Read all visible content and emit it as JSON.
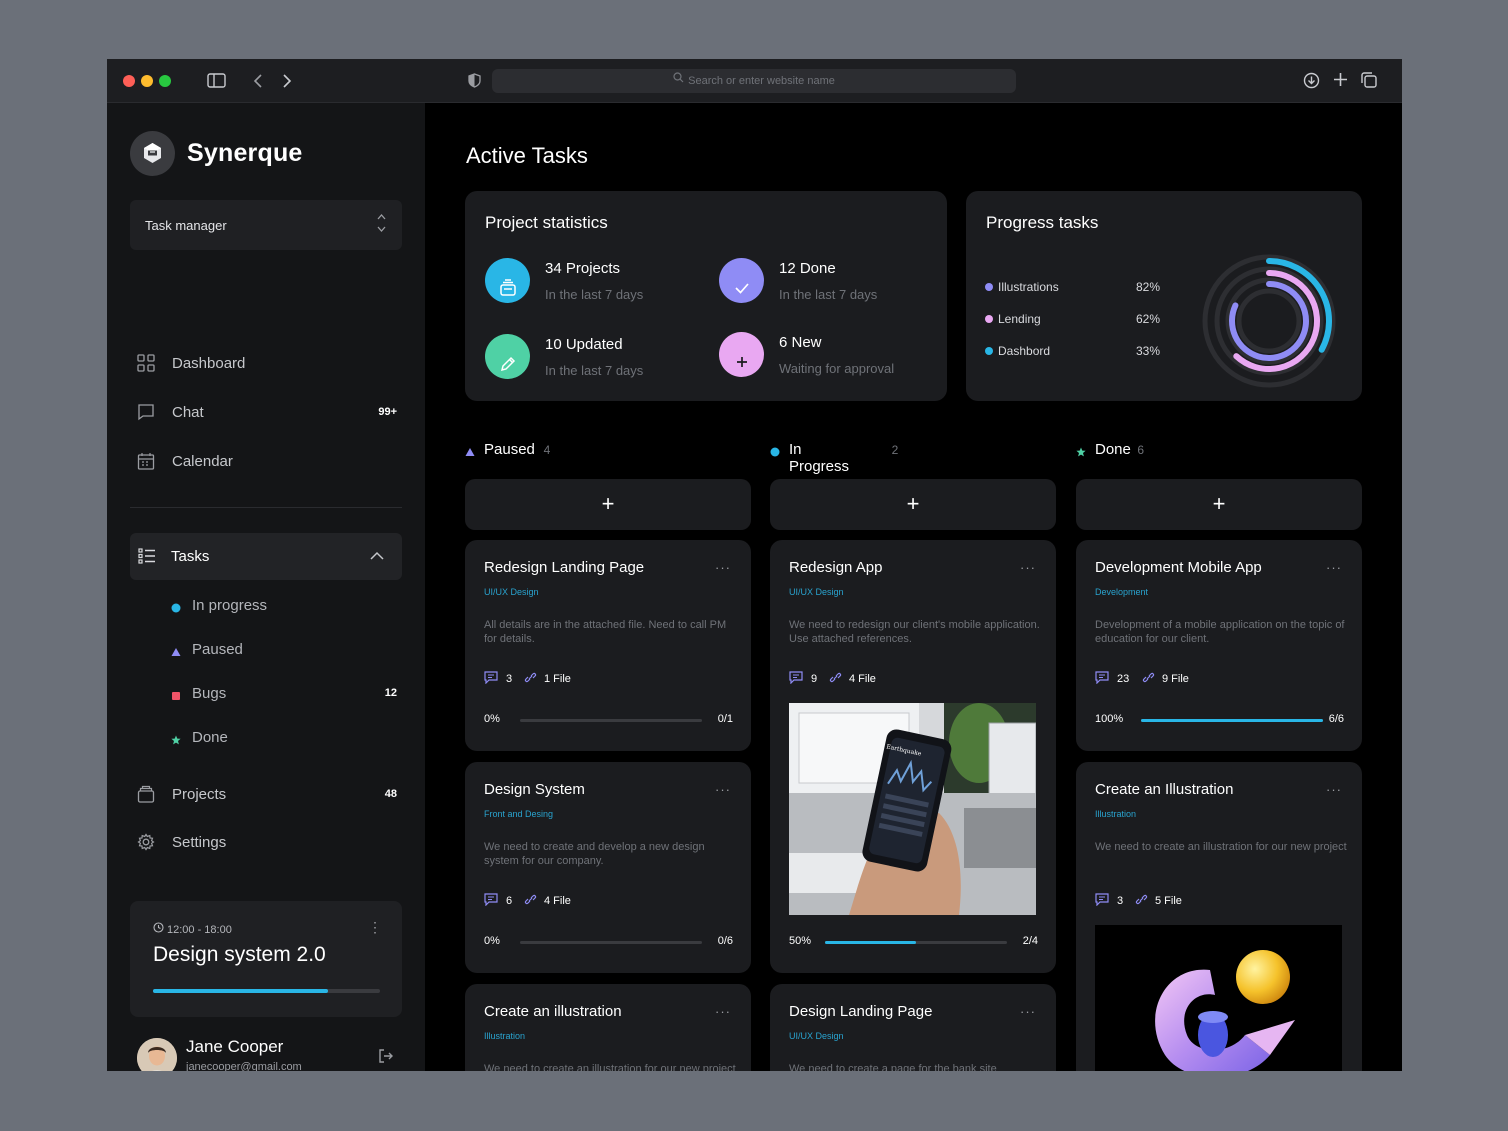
{
  "browser": {
    "url_placeholder": "Search or enter website name"
  },
  "brand": {
    "name": "Synerque"
  },
  "workspace_selector": {
    "value": "Task manager"
  },
  "nav": [
    {
      "label": "Dashboard",
      "icon": "grid-icon",
      "badge": ""
    },
    {
      "label": "Chat",
      "icon": "chat-icon",
      "badge": "99+"
    },
    {
      "label": "Calendar",
      "icon": "calendar-icon",
      "badge": ""
    }
  ],
  "tasks_menu": {
    "label": "Tasks",
    "items": [
      {
        "label": "In progress",
        "marker": "circle",
        "color": "#29b6e6",
        "badge": ""
      },
      {
        "label": "Paused",
        "marker": "triangle",
        "color": "#8f8cf5",
        "badge": ""
      },
      {
        "label": "Bugs",
        "marker": "square",
        "color": "#f05468",
        "badge": "12"
      },
      {
        "label": "Done",
        "marker": "star",
        "color": "#4fd1a5",
        "badge": ""
      }
    ]
  },
  "nav2": [
    {
      "label": "Projects",
      "icon": "folder-icon",
      "badge": "48"
    },
    {
      "label": "Settings",
      "icon": "gear-icon",
      "badge": ""
    }
  ],
  "event": {
    "time": "12:00 - 18:00",
    "title": "Design system 2.0",
    "progress": 0.77
  },
  "user": {
    "name": "Jane Cooper",
    "email": "janecooper@gmail.com"
  },
  "page_title": "Active Tasks",
  "stats": {
    "title": "Project statistics",
    "items": [
      {
        "value": "34 Projects",
        "sub": "In the last 7 days",
        "color": "#29b6e6",
        "icon": "stack-icon"
      },
      {
        "value": "12 Done",
        "sub": "In the last 7 days",
        "color": "#8f8cf5",
        "icon": "check-icon"
      },
      {
        "value": "10 Updated",
        "sub": "In the last 7 days",
        "color": "#4fd1a5",
        "icon": "pencil-icon"
      },
      {
        "value": "6 New",
        "sub": "Waiting for approval",
        "color": "#e9a8f2",
        "icon": "plus-icon"
      }
    ]
  },
  "progress": {
    "title": "Progress tasks",
    "items": [
      {
        "name": "Illustrations",
        "percent": "82%",
        "value": 0.82,
        "color": "#8f8cf5"
      },
      {
        "name": "Lending",
        "percent": "62%",
        "value": 0.62,
        "color": "#e9a8f2"
      },
      {
        "name": "Dashbord",
        "percent": "33%",
        "value": 0.33,
        "color": "#29b6e6"
      }
    ]
  },
  "columns": [
    {
      "name": "Paused",
      "count": "4",
      "marker": "triangle",
      "color": "#8f8cf5",
      "cards": [
        {
          "title": "Redesign Landing Page",
          "category": "UI/UX Design",
          "desc": "All details are in the attached file. Need to call PM for details.",
          "comments": "3",
          "files": "1 File",
          "percent": "0%",
          "ratio": "0/1",
          "progress": 0
        },
        {
          "title": "Design System",
          "category": "Front and Desing",
          "desc": "We need to create and develop a new design system for our company.",
          "comments": "6",
          "files": "4 File",
          "percent": "0%",
          "ratio": "0/6",
          "progress": 0
        },
        {
          "title": "Create an illustration",
          "category": "Illustration",
          "desc": "We need to create an illustration for our new project"
        }
      ]
    },
    {
      "name": "In Progress",
      "count": "2",
      "marker": "circle",
      "color": "#29b6e6",
      "cards": [
        {
          "title": "Redesign App",
          "category": "UI/UX Design",
          "desc": "We need to redesign our client's mobile application. Use attached references.",
          "comments": "9",
          "files": "4 File",
          "percent": "50%",
          "ratio": "2/4",
          "progress": 0.5,
          "phone_title": "Earthquake"
        },
        {
          "title": "Design Landing Page",
          "category": "UI/UX Design",
          "desc": "We need to create a page for the bank site"
        }
      ]
    },
    {
      "name": "Done",
      "count": "6",
      "marker": "star",
      "color": "#4fd1a5",
      "cards": [
        {
          "title": "Development Mobile App",
          "category": "Development",
          "desc": "Development of a mobile application on the topic of education for our client.",
          "comments": "23",
          "files": "9 File",
          "percent": "100%",
          "ratio": "6/6",
          "progress": 1
        },
        {
          "title": "Create an Illustration",
          "category": "Illustration",
          "desc": "We need to create an illustration for our new project",
          "comments": "3",
          "files": "5 File"
        }
      ]
    }
  ],
  "add_symbol": "+"
}
